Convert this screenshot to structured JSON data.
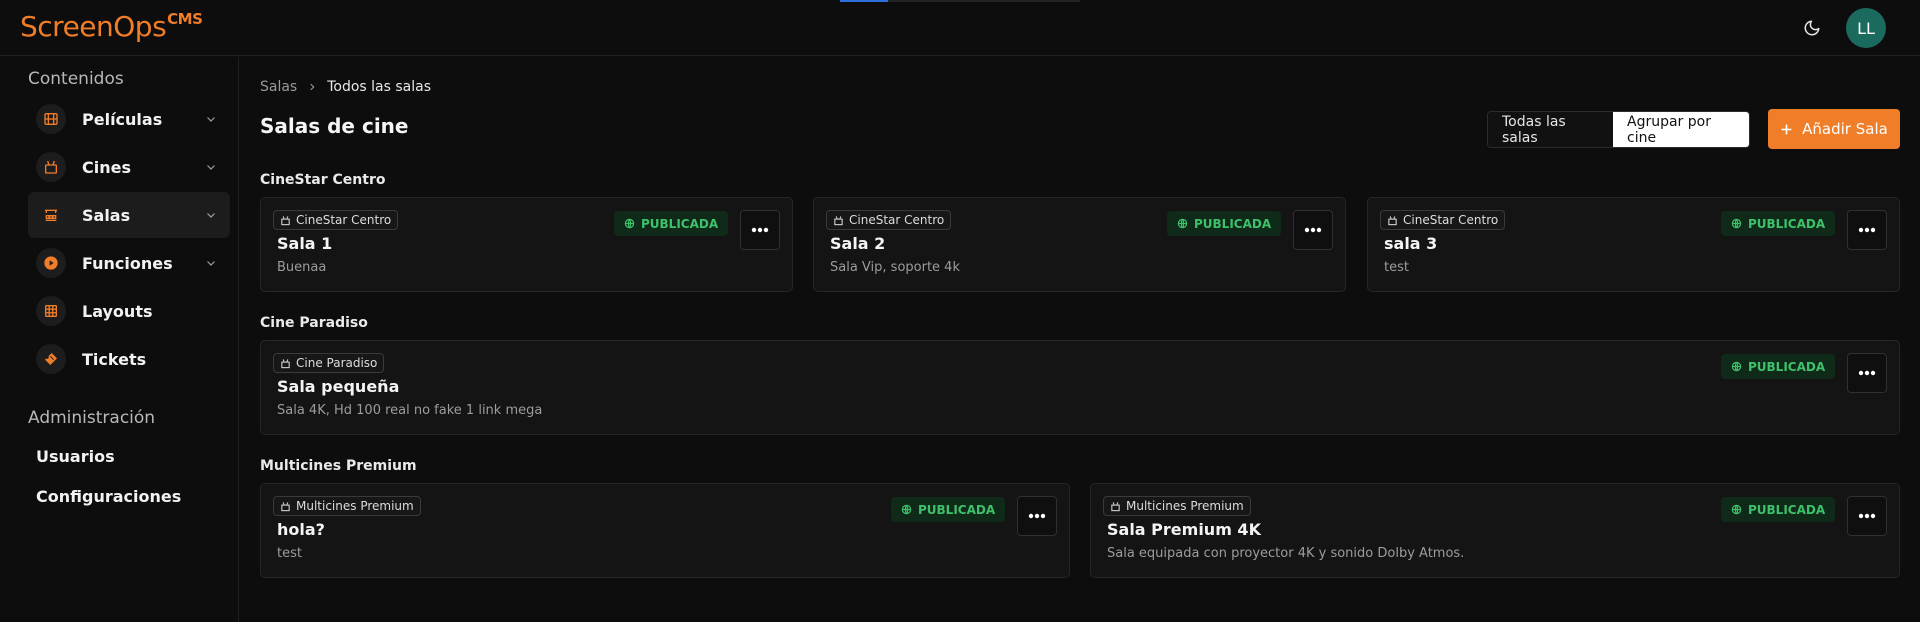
{
  "header": {
    "logo_text": "ScreenOps",
    "logo_suffix": "CMS",
    "avatar_initials": "LL",
    "brand_color": "#f07d28"
  },
  "sidebar": {
    "section_content": "Contenidos",
    "items": [
      {
        "label": "Películas",
        "icon": "film-icon",
        "expandable": true
      },
      {
        "label": "Cines",
        "icon": "cinema-icon",
        "expandable": true
      },
      {
        "label": "Salas",
        "icon": "screening-room-icon",
        "expandable": true,
        "active": true
      },
      {
        "label": "Funciones",
        "icon": "play-circle-icon",
        "expandable": true
      },
      {
        "label": "Layouts",
        "icon": "grid-icon",
        "expandable": false
      },
      {
        "label": "Tickets",
        "icon": "ticket-icon",
        "expandable": false
      }
    ],
    "section_admin": "Administración",
    "admin_items": [
      {
        "label": "Usuarios"
      },
      {
        "label": "Configuraciones"
      }
    ]
  },
  "main": {
    "breadcrumb": {
      "root": "Salas",
      "current": "Todos las salas"
    },
    "title": "Salas de cine",
    "view_toggle": {
      "all": "Todas las salas",
      "grouped": "Agrupar por cine",
      "selected": "grouped"
    },
    "add_button": "Añadir Sala",
    "groups": [
      {
        "name": "CineStar Centro",
        "rooms": [
          {
            "cinema": "CineStar Centro",
            "name": "Sala 1",
            "description": "Buenaa",
            "status": "PUBLICADA"
          },
          {
            "cinema": "CineStar Centro",
            "name": "Sala 2",
            "description": "Sala Vip, soporte 4k",
            "status": "PUBLICADA"
          },
          {
            "cinema": "CineStar Centro",
            "name": "sala 3",
            "description": "test",
            "status": "PUBLICADA"
          }
        ]
      },
      {
        "name": "Cine Paradiso",
        "rooms": [
          {
            "cinema": "Cine Paradiso",
            "name": "Sala pequeña",
            "description": "Sala 4K, Hd 100 real no fake 1 link mega",
            "status": "PUBLICADA"
          }
        ]
      },
      {
        "name": "Multicines Premium",
        "rooms": [
          {
            "cinema": "Multicines Premium",
            "name": "hola?",
            "description": "test",
            "status": "PUBLICADA"
          },
          {
            "cinema": "Multicines Premium",
            "name": "Sala Premium 4K",
            "description": "Sala equipada con proyector 4K y sonido Dolby Atmos.",
            "status": "PUBLICADA"
          }
        ]
      }
    ]
  }
}
